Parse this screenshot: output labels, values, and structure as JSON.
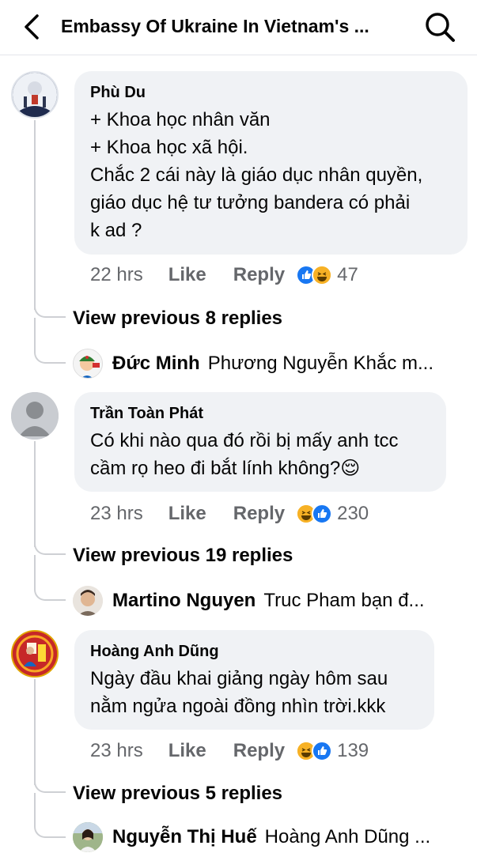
{
  "header": {
    "title": "Embassy Of Ukraine In Vietnam's ..."
  },
  "comments": [
    {
      "author": "Phù Du",
      "text": "+ Khoa học nhân văn\n+ Khoa học xã hội.\nChắc 2 cái này là giáo dục nhân quyền,\ngiáo dục hệ tư tưởng bandera có phải\nk ad ?",
      "time": "22 hrs",
      "like_label": "Like",
      "reply_label": "Reply",
      "reaction_count": "47",
      "view_previous": "View previous 8 replies",
      "latest_reply": {
        "name": "Đức Minh",
        "text": "Phương Nguyễn Khắc m..."
      }
    },
    {
      "author": "Trần Toàn Phát",
      "text": "Có khi nào qua đó rồi bị mấy anh tcc\ncầm rọ heo đi bắt lính không?😌",
      "time": "23 hrs",
      "like_label": "Like",
      "reply_label": "Reply",
      "reaction_count": "230",
      "view_previous": "View previous 19 replies",
      "latest_reply": {
        "name": "Martino Nguyen",
        "text": "Truc Pham bạn đ..."
      }
    },
    {
      "author": "Hoàng Anh Dũng",
      "text": "Ngày đầu khai giảng ngày hôm sau\nnằm ngửa ngoài đồng nhìn trời.kkk",
      "time": "23 hrs",
      "like_label": "Like",
      "reply_label": "Reply",
      "reaction_count": "139",
      "view_previous": "View previous 5 replies",
      "latest_reply": {
        "name": "Nguyễn Thị Huế",
        "text": "Hoàng Anh Dũng  ..."
      }
    }
  ],
  "colors": {
    "like_blue": "#1877f2",
    "haha_yellow": "#f7b125",
    "bubble_bg": "#f0f2f5",
    "meta_gray": "#65676b"
  }
}
